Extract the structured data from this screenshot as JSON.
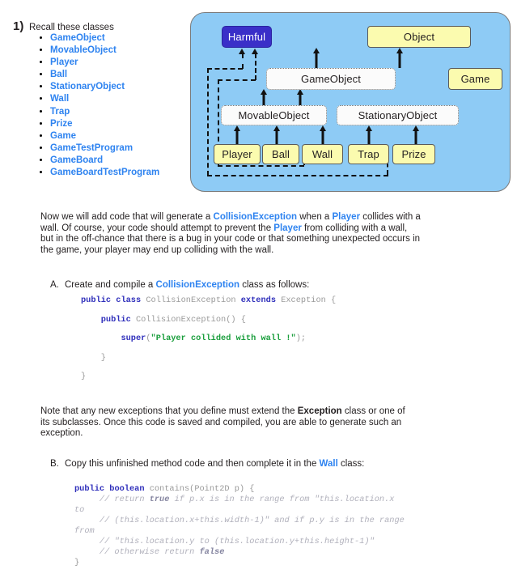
{
  "question": {
    "number": "1)",
    "title": "Recall these classes",
    "classes": [
      "GameObject",
      "MovableObject",
      "Player",
      "Ball",
      "StationaryObject",
      "Wall",
      "Trap",
      "Prize",
      "Game",
      "GameTestProgram",
      "GameBoard",
      "GameBoardTestProgram"
    ]
  },
  "diagram": {
    "name": "uml-class-hierarchy",
    "background_color": "#8ecbf5",
    "nodes": [
      {
        "id": "harmful",
        "label": "Harmful",
        "style": "interface",
        "color": "#3a2fc8"
      },
      {
        "id": "object",
        "label": "Object",
        "style": "class",
        "color": "#fbfbaf"
      },
      {
        "id": "game",
        "label": "Game",
        "style": "class",
        "color": "#fbfbaf"
      },
      {
        "id": "gameobject",
        "label": "GameObject",
        "style": "abstract",
        "color": "#fbfbfb"
      },
      {
        "id": "movableobject",
        "label": "MovableObject",
        "style": "abstract",
        "color": "#fbfbfb"
      },
      {
        "id": "stationaryobject",
        "label": "StationaryObject",
        "style": "abstract",
        "color": "#fbfbfb"
      },
      {
        "id": "player",
        "label": "Player",
        "style": "class",
        "color": "#fbfbaf"
      },
      {
        "id": "ball",
        "label": "Ball",
        "style": "class",
        "color": "#fbfbaf"
      },
      {
        "id": "wall",
        "label": "Wall",
        "style": "class",
        "color": "#fbfbaf"
      },
      {
        "id": "trap",
        "label": "Trap",
        "style": "class",
        "color": "#fbfbaf"
      },
      {
        "id": "prize",
        "label": "Prize",
        "style": "class",
        "color": "#fbfbaf"
      }
    ],
    "edges": [
      {
        "from": "gameobject",
        "to": "object",
        "type": "solid"
      },
      {
        "from": "game",
        "to": "object",
        "type": "solid"
      },
      {
        "from": "movableobject",
        "to": "gameobject",
        "type": "solid"
      },
      {
        "from": "stationaryobject",
        "to": "gameobject",
        "type": "solid"
      },
      {
        "from": "player",
        "to": "movableobject",
        "type": "solid"
      },
      {
        "from": "ball",
        "to": "movableobject",
        "type": "solid"
      },
      {
        "from": "wall",
        "to": "stationaryobject",
        "type": "solid"
      },
      {
        "from": "trap",
        "to": "stationaryobject",
        "type": "solid"
      },
      {
        "from": "prize",
        "to": "stationaryobject",
        "type": "solid"
      },
      {
        "from": "ball",
        "to": "harmful",
        "type": "dashed"
      },
      {
        "from": "trap",
        "to": "harmful",
        "type": "dashed"
      }
    ]
  },
  "intro_paragraph": {
    "line1_a": "Now we will add code that will generate a ",
    "line1_kw1": "CollisionException",
    "line1_b": " when a ",
    "line1_kw2": "Player",
    "line1_c": " collides with a",
    "line2_a": "wall. Of course, your code should attempt to prevent the ",
    "line2_kw1": "Player",
    "line2_b": " from colliding with a wall,",
    "line3": "but in the off-chance that there is a bug in your code or that something unexpected occurs in",
    "line4": "the game, your player may end up colliding with the wall."
  },
  "step_a": {
    "label": "A.",
    "text_a": "Create and compile a ",
    "kw": "CollisionException",
    "text_b": " class as follows:"
  },
  "code_a": {
    "lines": [
      {
        "tokens": [
          {
            "t": "public ",
            "c": "kw"
          },
          {
            "t": "class ",
            "c": "kw"
          },
          {
            "t": "CollisionException ",
            "c": "pl"
          },
          {
            "t": "extends ",
            "c": "kw"
          },
          {
            "t": "Exception {",
            "c": "pl"
          }
        ]
      },
      {
        "tokens": [
          {
            "t": "    ",
            "c": "pl"
          },
          {
            "t": "public ",
            "c": "kw"
          },
          {
            "t": "CollisionException() {",
            "c": "pl"
          }
        ]
      },
      {
        "tokens": [
          {
            "t": "        ",
            "c": "pl"
          },
          {
            "t": "super",
            "c": "kw"
          },
          {
            "t": "(",
            "c": "pl"
          },
          {
            "t": "\"Player collided with wall !\"",
            "c": "str"
          },
          {
            "t": ");",
            "c": "pl"
          }
        ]
      },
      {
        "tokens": [
          {
            "t": "    }",
            "c": "pl"
          }
        ]
      },
      {
        "tokens": [
          {
            "t": "}",
            "c": "pl"
          }
        ]
      }
    ]
  },
  "note_paragraph": {
    "line1_a": "Note that any new exceptions that you define must extend the ",
    "line1_bold": "Exception",
    "line1_b": " class or one of",
    "line2": "its subclasses. Once this code is saved and compiled, you are able to generate such an",
    "line3": "exception."
  },
  "step_b": {
    "label": "B.",
    "text_a": "Copy this unfinished method code and then complete it in the ",
    "kw": "Wall",
    "text_b": " class:"
  },
  "code_b": {
    "lines": [
      {
        "tokens": [
          {
            "t": "public ",
            "c": "kw"
          },
          {
            "t": "boolean ",
            "c": "kw"
          },
          {
            "t": "contains(Point2D p) {",
            "c": "pl"
          }
        ]
      },
      {
        "tokens": [
          {
            "t": "     // return ",
            "c": "cmt"
          },
          {
            "t": "true",
            "c": "cmtb"
          },
          {
            "t": " if p.x is in the range from \"this.location.x",
            "c": "cmt"
          }
        ]
      },
      {
        "tokens": [
          {
            "t": "to",
            "c": "cmt"
          }
        ]
      },
      {
        "tokens": [
          {
            "t": "     // (this.location.x+this.width-1)\" and if p.y is in the range",
            "c": "cmt"
          }
        ]
      },
      {
        "tokens": [
          {
            "t": "from",
            "c": "cmt"
          }
        ]
      },
      {
        "tokens": [
          {
            "t": "     // \"this.location.y to (this.location.y+this.height-1)\"",
            "c": "cmt"
          }
        ]
      },
      {
        "tokens": [
          {
            "t": "     // otherwise return ",
            "c": "cmt"
          },
          {
            "t": "false",
            "c": "cmtb"
          }
        ]
      },
      {
        "tokens": [
          {
            "t": "}",
            "c": "pl"
          }
        ]
      }
    ]
  }
}
